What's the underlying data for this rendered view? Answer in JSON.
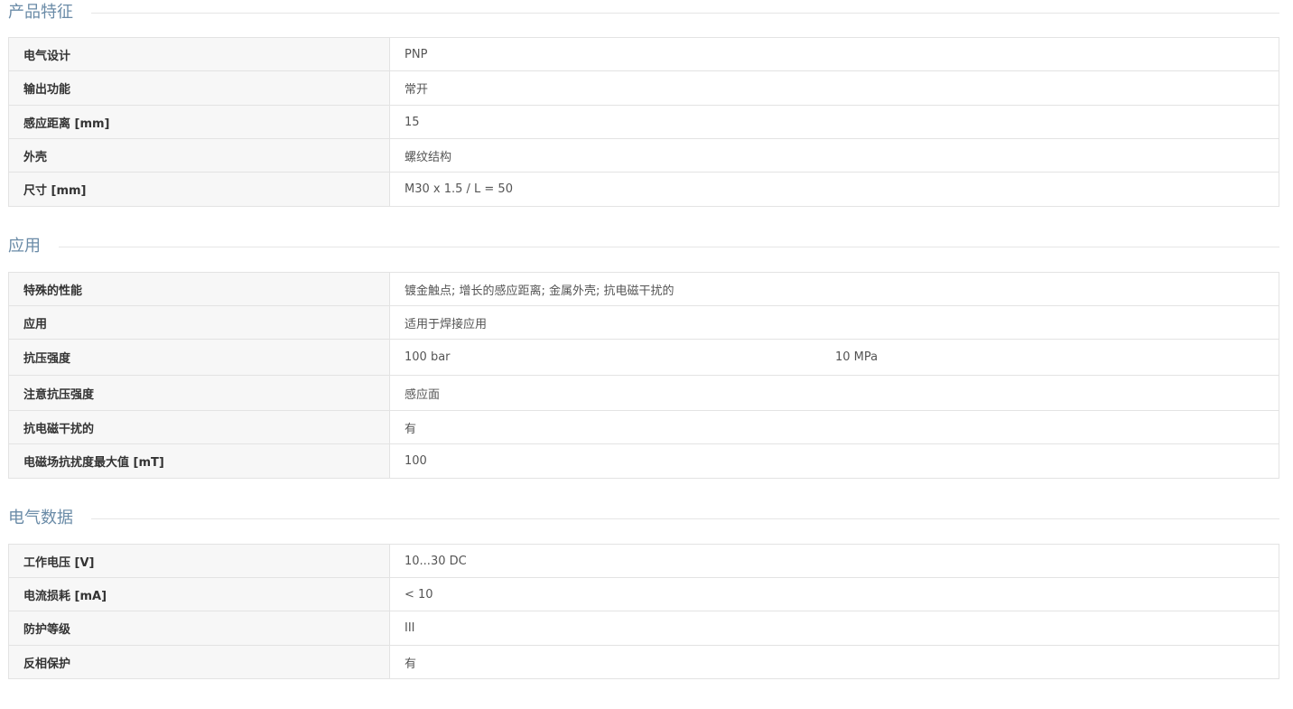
{
  "sections": [
    {
      "title": "产品特征",
      "rows": [
        {
          "label": "电气设计",
          "value": "PNP"
        },
        {
          "label": "输出功能",
          "value": "常开"
        },
        {
          "label": "感应距离 [mm]",
          "value": "15"
        },
        {
          "label": "外壳",
          "value": "螺纹结构"
        },
        {
          "label": "尺寸 [mm]",
          "value": "M30 x 1.5 / L = 50"
        }
      ]
    },
    {
      "title": "应用",
      "rows": [
        {
          "label": "特殊的性能",
          "value": "镀金触点; 增长的感应距离; 金属外壳; 抗电磁干扰的"
        },
        {
          "label": "应用",
          "value": "适用于焊接应用"
        },
        {
          "label": "抗压强度",
          "value": "100 bar",
          "value2": "10 MPa"
        },
        {
          "label": "注意抗压强度",
          "value": "感应面"
        },
        {
          "label": "抗电磁干扰的",
          "value": "有"
        },
        {
          "label": "电磁场抗扰度最大值 [mT]",
          "value": "100"
        }
      ]
    },
    {
      "title": "电气数据",
      "rows": [
        {
          "label": "工作电压 [V]",
          "value": "10...30 DC"
        },
        {
          "label": "电流损耗 [mA]",
          "value": "< 10"
        },
        {
          "label": "防护等级",
          "value": "III"
        },
        {
          "label": "反相保护",
          "value": "有"
        }
      ]
    }
  ]
}
